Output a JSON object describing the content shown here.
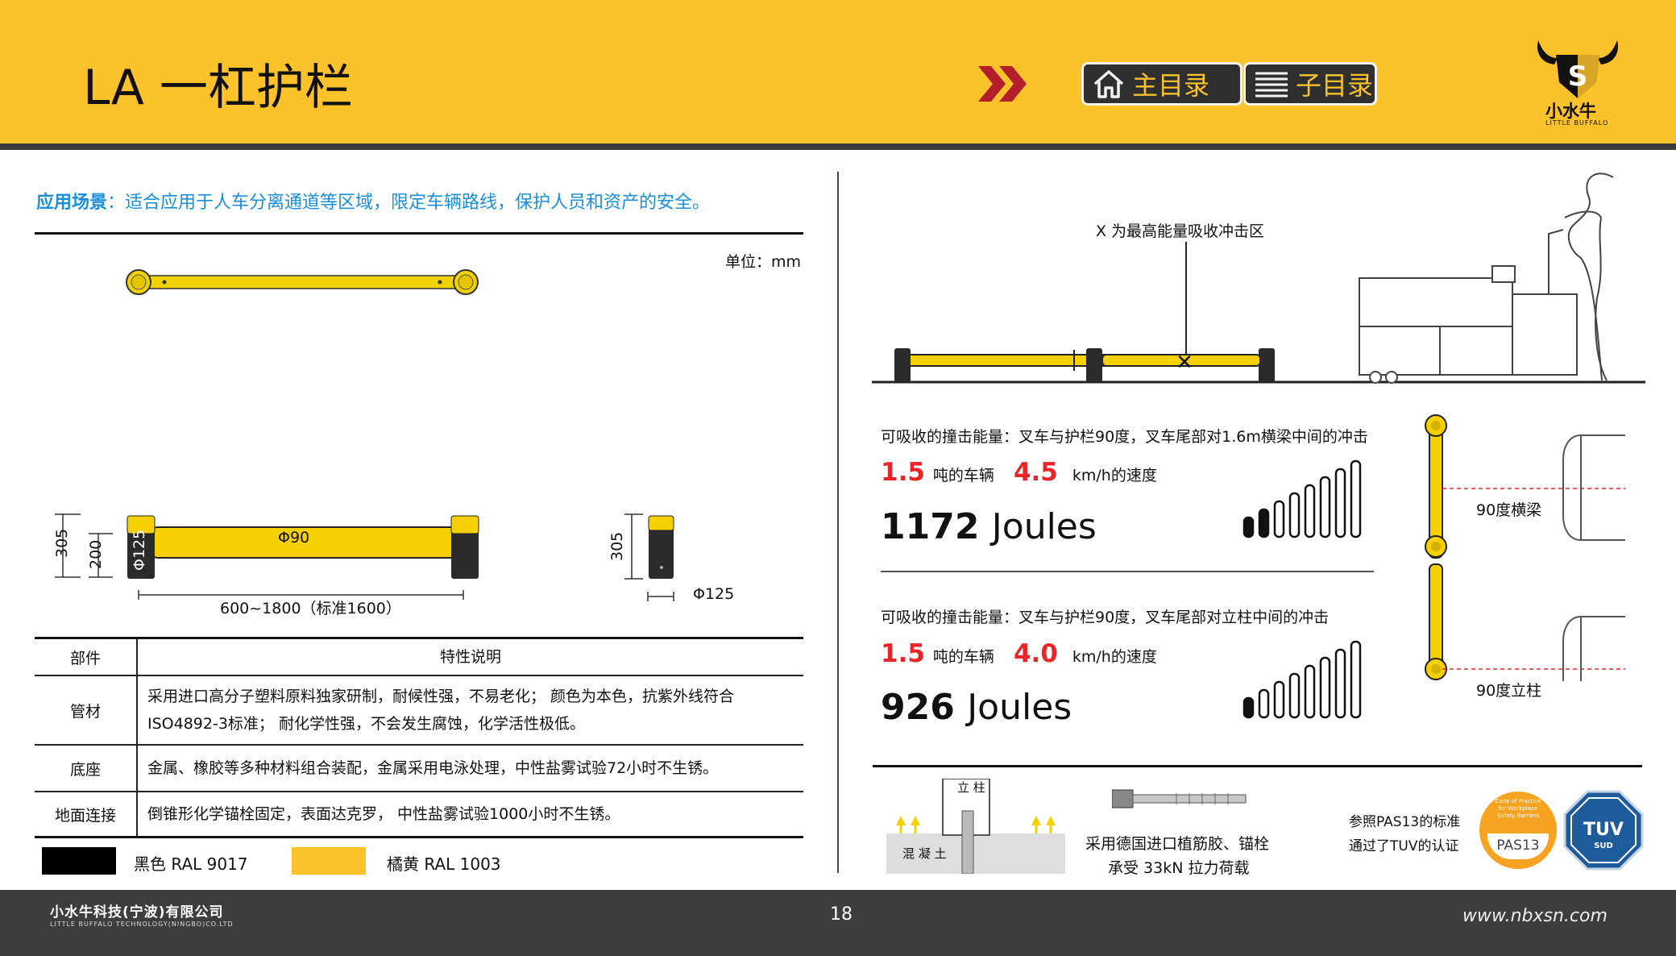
{
  "header": {
    "title": "LA 一杠护栏",
    "main_menu_label": "主目录",
    "sub_menu_label": "子目录",
    "logo_name": "小水牛",
    "logo_en": "LITTLE BUFFALO",
    "logo_letter": "S"
  },
  "scenario": {
    "label": "应用场景",
    "text": "：适合应用于人车分离通道等区域，限定车辆路线，保护人员和资产的安全。"
  },
  "drawing": {
    "unit": "单位：mm",
    "pipe_diameter": "Φ90",
    "post_diameter_vertical": "Φ125",
    "height_total": "305",
    "height_pipe": "200",
    "length": "600~1800（标准1600）",
    "side_height": "305",
    "side_diameter": "Φ125"
  },
  "table": {
    "headers": [
      "部件",
      "特性说明"
    ],
    "rows": [
      {
        "part": "管材",
        "desc": [
          "采用进口高分子塑料原料独家研制，耐候性强，不易老化； 颜色为本色，抗紫外线符合",
          "ISO4892-3标准； 耐化学性强，不会发生腐蚀，化学活性极低。"
        ]
      },
      {
        "part": "底座",
        "desc": [
          "金属、橡胶等多种材料组合装配，金属采用电泳处理，中性盐雾试验72小时不生锈。"
        ]
      },
      {
        "part": "地面连接",
        "desc": [
          "倒锥形化学锚栓固定，表面达克罗， 中性盐雾试验1000小时不生锈。"
        ]
      }
    ]
  },
  "colors": {
    "black_label": "黑色  RAL 9017",
    "yellow_label": "橘黄  RAL 1003",
    "black_hex": "#000000",
    "yellow_hex": "#fcc22b"
  },
  "impact": {
    "zone_label": "X 为最高能量吸收冲击区",
    "case1": {
      "desc": "可吸收的撞击能量：叉车与护栏90度，叉车尾部对1.6m横梁中间的冲击",
      "tons": "1.5",
      "tons_suffix": "吨的车辆",
      "speed": "4.5",
      "speed_suffix": "km/h的速度",
      "energy_value": "1172",
      "energy_unit": "Joules",
      "bars_filled": 2
    },
    "case2": {
      "desc": "可吸收的撞击能量：叉车与护栏90度，叉车尾部对立柱中间的冲击",
      "tons": "1.5",
      "tons_suffix": "吨的车辆",
      "speed": "4.0",
      "speed_suffix": "km/h的速度",
      "energy_value": "926",
      "energy_unit": "Joules",
      "bars_filled": 1
    },
    "beam_label": "90度横梁",
    "post_label": "90度立柱"
  },
  "anchor": {
    "post_label": "立 柱",
    "concrete_label": "混 凝 土",
    "text_line1": "采用德国进口植筋胶、锚栓",
    "text_line2": "承受 33kN 拉力荷载"
  },
  "cert": {
    "line1": "参照PAS13的标准",
    "line2": "通过了TUV的认证",
    "pas_badge": "PAS13",
    "pas_small": "Code of Practice for Workplace Safety Barriers",
    "tuv_badge": "TUV",
    "tuv_sub": "SUD"
  },
  "footer": {
    "company_cn": "小水牛科技(宁波)有限公司",
    "company_en": "LITTLE BUFFALO TECHNOLOGY(NINGBO)CO.LTD",
    "page": "18",
    "website": "www.nbxsn.com"
  }
}
